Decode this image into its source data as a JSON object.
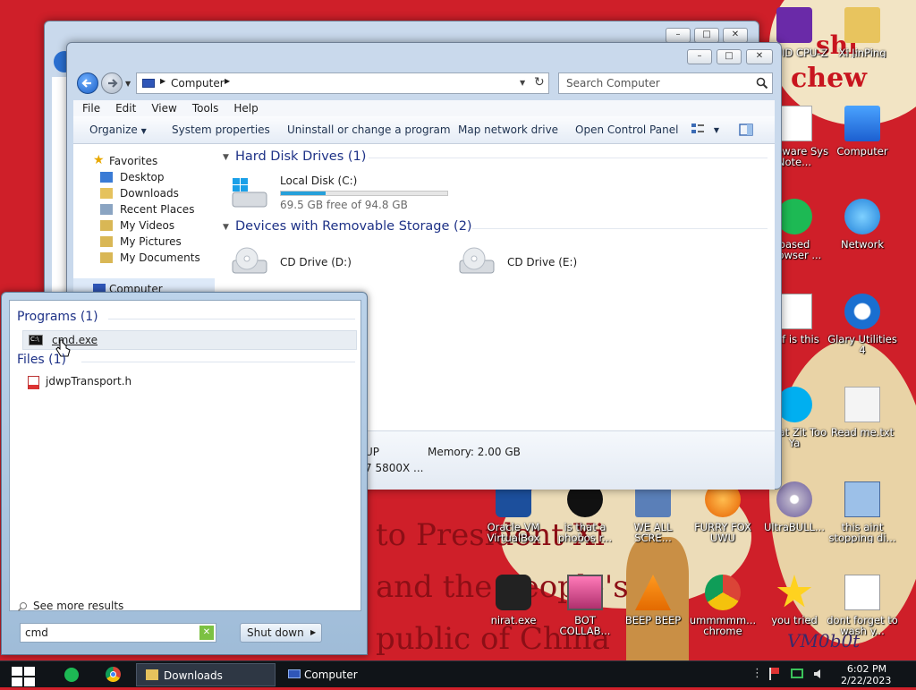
{
  "wallpaper": {
    "texts": [
      "to President Xi",
      "and the People's",
      "public of China",
      "chew",
      "shi"
    ],
    "signature": "VM0b0t"
  },
  "desktop_icons": [
    {
      "label": "CPUID CPU-Z",
      "icon": "cpuz-icon"
    },
    {
      "label": "Xi JinPing",
      "icon": "folder-user-icon"
    },
    {
      "label": "Freeware Sys Note...",
      "icon": "document-icon"
    },
    {
      "label": "Computer",
      "icon": "computer-icon"
    },
    {
      "label": "based browser ...",
      "icon": "spotify-icon"
    },
    {
      "label": "Network",
      "icon": "network-icon"
    },
    {
      "label": "wtf is this",
      "icon": "calendar-doc-icon"
    },
    {
      "label": "Glary Utilities 4",
      "icon": "glary-icon"
    },
    {
      "label": "What Zit Too Ya",
      "icon": "skype-icon"
    },
    {
      "label": "Read me.txt",
      "icon": "text-file-icon"
    },
    {
      "label": "Oracle VM VirtualBox",
      "icon": "virtualbox-icon"
    },
    {
      "label": "is that a phobos r...",
      "icon": "clover-icon"
    },
    {
      "label": "WE ALL SCRE...",
      "icon": "installer-icon"
    },
    {
      "label": "FURRY FOX UWU",
      "icon": "firefox-icon"
    },
    {
      "label": "UltraBULL...",
      "icon": "disc-icon"
    },
    {
      "label": "this aint stopping di...",
      "icon": "network-pc-icon"
    },
    {
      "label": "nirat.exe",
      "icon": "skull-icon"
    },
    {
      "label": "BOT COLLAB...",
      "icon": "monitor-pink-icon"
    },
    {
      "label": "BEEP BEEP",
      "icon": "vlc-icon"
    },
    {
      "label": "ummmmm... chrome",
      "icon": "chrome-icon"
    },
    {
      "label": "you tried",
      "icon": "star-icon"
    },
    {
      "label": "dont forget to wash y...",
      "icon": "calendar-doc-icon"
    }
  ],
  "explorer": {
    "breadcrumb": "Computer",
    "search_placeholder": "Search Computer",
    "menu": [
      "File",
      "Edit",
      "View",
      "Tools",
      "Help"
    ],
    "commands": [
      "Organize",
      "System properties",
      "Uninstall or change a program",
      "Map network drive",
      "Open Control Panel"
    ],
    "nav": {
      "favorites_label": "Favorites",
      "items": [
        "Desktop",
        "Downloads",
        "Recent Places",
        "My Videos",
        "My Pictures",
        "My Documents"
      ],
      "computer_label": "Computer"
    },
    "hard_disk_group": "Hard Disk Drives (1)",
    "local_disk": {
      "name": "Local Disk (C:)",
      "free": "69.5 GB free of 94.8 GB",
      "used_fraction": 0.267
    },
    "removable_group": "Devices with Removable Storage (2)",
    "cd_drives": [
      "CD Drive (D:)",
      "CD Drive (E:)"
    ],
    "details": {
      "memory": "Memory: 2.00 GB",
      "processor_partial": "7 5800X ...",
      "workgroup_partial": "UP"
    }
  },
  "start_menu": {
    "programs_header": "Programs (1)",
    "program_item": "cmd.exe",
    "files_header": "Files (1)",
    "file_item": "jdwpTransport.h",
    "see_more": "See more results",
    "search_value": "cmd",
    "shutdown_label": "Shut down"
  },
  "taskbar": {
    "buttons": [
      "Downloads",
      "Computer"
    ],
    "time": "6:02 PM",
    "date": "2/22/2023"
  },
  "colors": {
    "wallpaper": "#cf1f29",
    "link": "#1e3287",
    "taskbar": "#101418"
  }
}
